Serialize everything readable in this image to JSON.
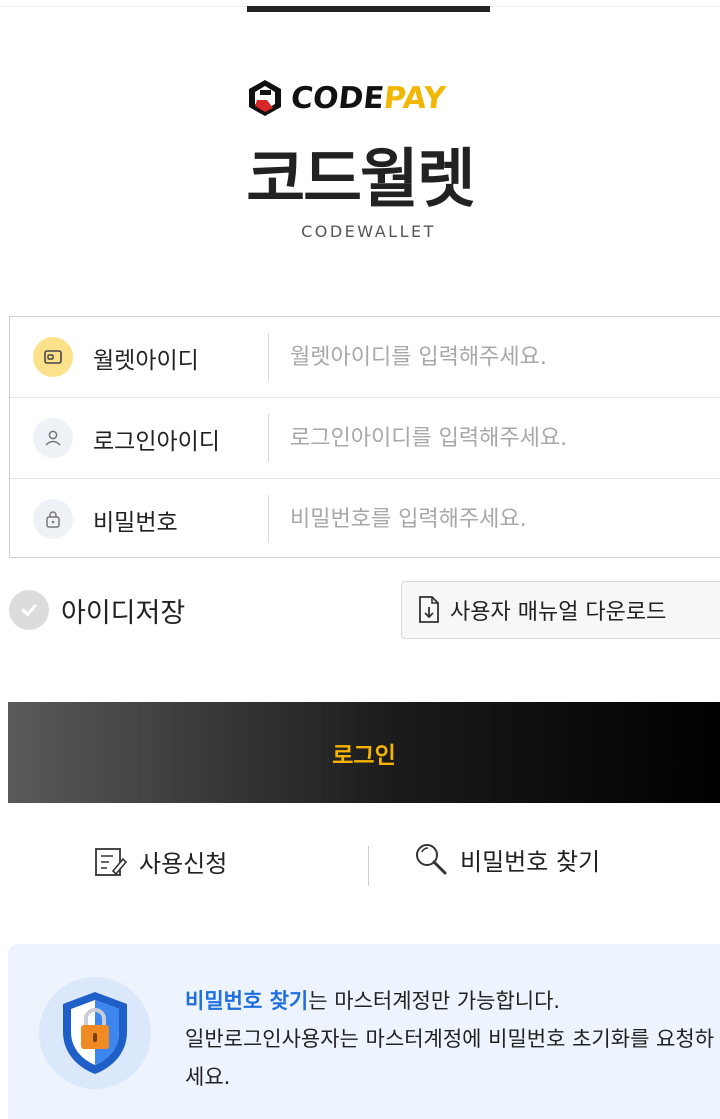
{
  "brand": {
    "logo_code": "CODE",
    "logo_pay": "PAY",
    "title": "코드월렛",
    "subtitle": "CODEWALLET",
    "colors": {
      "accent": "#f2b705",
      "button_text": "#f6b400",
      "link_blue": "#1f6fe0"
    }
  },
  "form": {
    "fields": [
      {
        "label": "월렛아이디",
        "placeholder": "월렛아이디를 입력해주세요.",
        "value": "",
        "icon": "wallet-icon"
      },
      {
        "label": "로그인아이디",
        "placeholder": "로그인아이디를 입력해주세요.",
        "value": "",
        "icon": "user-icon"
      },
      {
        "label": "비밀번호",
        "placeholder": "비밀번호를 입력해주세요.",
        "value": "",
        "icon": "lock-icon"
      }
    ]
  },
  "options": {
    "save_id_label": "아이디저장",
    "save_id_checked": false,
    "manual_label": "사용자 매뉴얼 다운로드"
  },
  "login_label": "로그인",
  "links": {
    "apply_label": "사용신청",
    "find_password_label": "비밀번호 찾기"
  },
  "notice": {
    "highlight": "비밀번호 찾기",
    "line1_rest": "는 마스터계정만 가능합니다.",
    "line2": "일반로그인사용자는 마스터계정에 비밀번호 초기화를 요청하세요."
  }
}
